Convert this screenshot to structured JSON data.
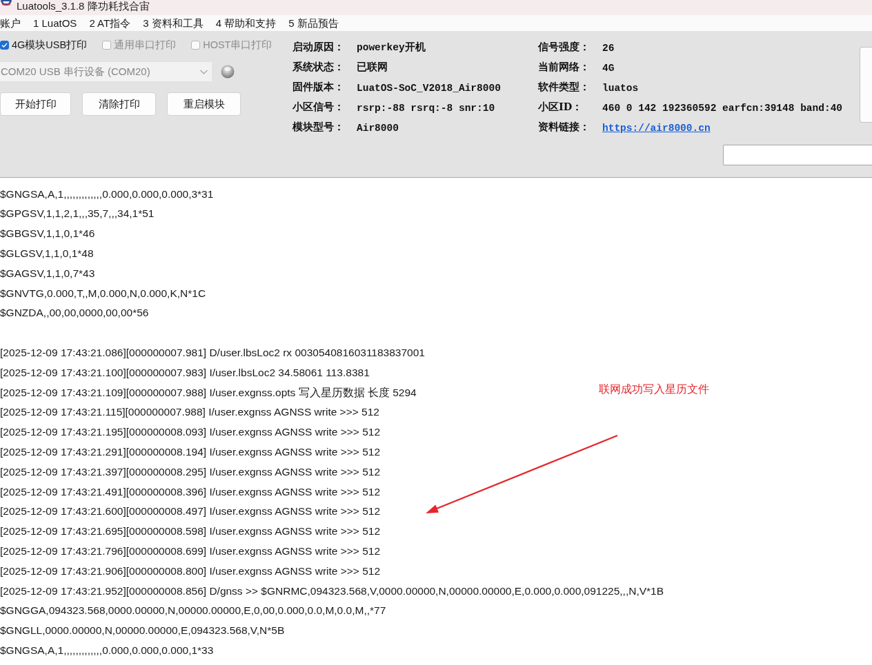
{
  "window": {
    "title": "Luatools_3.1.8 降功耗找合宙"
  },
  "menu": [
    "账户",
    "1 LuatOS",
    "2 AT指令",
    "3 资料和工具",
    "4 帮助和支持",
    "5 新品预告"
  ],
  "print_options": [
    {
      "label": "4G模块USB打印",
      "checked": true,
      "disabled": false
    },
    {
      "label": "通用串口打印",
      "checked": false,
      "disabled": true
    },
    {
      "label": "HOST串口打印",
      "checked": false,
      "disabled": true
    }
  ],
  "port_select": {
    "value": "COM20 USB 串行设备 (COM20)",
    "disabled": true
  },
  "buttons": [
    "开始打印",
    "清除打印",
    "重启模块"
  ],
  "device_info": [
    {
      "label": "启动原因：",
      "value": "powerkey开机",
      "kind": "text"
    },
    {
      "label": "信号强度：",
      "value": "26",
      "kind": "text"
    },
    {
      "label": "系统状态：",
      "value": "已联网",
      "kind": "text"
    },
    {
      "label": "当前网络：",
      "value": "4G",
      "kind": "text"
    },
    {
      "label": "固件版本：",
      "value": "LuatOS-SoC_V2018_Air8000",
      "kind": "text"
    },
    {
      "label": "软件类型：",
      "value": "luatos",
      "kind": "text"
    },
    {
      "label": "小区信号：",
      "value": "rsrp:-88 rsrq:-8 snr:10",
      "kind": "text"
    },
    {
      "label": "小区ID：",
      "value": "460 0 142 192360592 earfcn:39148 band:40",
      "kind": "text"
    },
    {
      "label": "模块型号：",
      "value": "Air8000",
      "kind": "text"
    },
    {
      "label": "资料链接：",
      "value": "https://air8000.cn",
      "kind": "link"
    }
  ],
  "log": {
    "groups": [
      {
        "lines": [
          "$GNGSA,A,1,,,,,,,,,,,,,0.000,0.000,0.000,3*31",
          "$GPGSV,1,1,2,1,,,35,7,,,34,1*51",
          "$GBGSV,1,1,0,1*46",
          "$GLGSV,1,1,0,1*48",
          "$GAGSV,1,1,0,7*43",
          "$GNVTG,0.000,T,,M,0.000,N,0.000,K,N*1C",
          "$GNZDA,,00,00,0000,00,00*56"
        ]
      },
      {
        "lines": [
          "[2025-12-09 17:43:21.086][000000007.981] D/user.lbsLoc2 rx 0030540816031183837001",
          "[2025-12-09 17:43:21.100][000000007.983] I/user.lbsLoc2 34.58061 113.8381",
          "[2025-12-09 17:43:21.109][000000007.988] I/user.exgnss.opts 写入星历数据 长度 5294",
          "[2025-12-09 17:43:21.115][000000007.988] I/user.exgnss AGNSS write >>> 512",
          "[2025-12-09 17:43:21.195][000000008.093] I/user.exgnss AGNSS write >>> 512",
          "[2025-12-09 17:43:21.291][000000008.194] I/user.exgnss AGNSS write >>> 512",
          "[2025-12-09 17:43:21.397][000000008.295] I/user.exgnss AGNSS write >>> 512",
          "[2025-12-09 17:43:21.491][000000008.396] I/user.exgnss AGNSS write >>> 512",
          "[2025-12-09 17:43:21.600][000000008.497] I/user.exgnss AGNSS write >>> 512",
          "[2025-12-09 17:43:21.695][000000008.598] I/user.exgnss AGNSS write >>> 512",
          "[2025-12-09 17:43:21.796][000000008.699] I/user.exgnss AGNSS write >>> 512",
          "[2025-12-09 17:43:21.906][000000008.800] I/user.exgnss AGNSS write >>> 512",
          "[2025-12-09 17:43:21.952][000000008.856] D/gnss >> $GNRMC,094323.568,V,0000.00000,N,00000.00000,E,0.000,0.000,091225,,,N,V*1B",
          "$GNGGA,094323.568,0000.00000,N,00000.00000,E,0,00,0.000,0.0,M,0.0,M,,*77",
          "$GNGLL,0000.00000,N,00000.00000,E,094323.568,V,N*5B",
          "$GNGSA,A,1,,,,,,,,,,,,,0.000,0.000,0.000,1*33"
        ]
      }
    ]
  },
  "annotation": {
    "text": "联网成功写入星历文件"
  }
}
